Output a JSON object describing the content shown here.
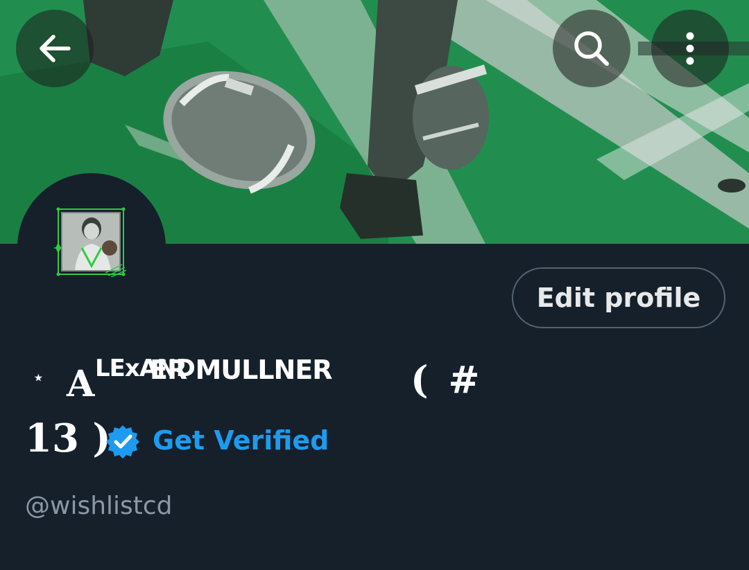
{
  "header": {
    "back_icon": "back-arrow-icon",
    "search_icon": "search-icon",
    "more_icon": "more-vertical-icon"
  },
  "profile": {
    "edit_label": "Edit profile",
    "name_star": "⋆",
    "name_cap_a": "A",
    "name_sup": "LExAND",
    "name_rest": "ER MULLNER",
    "name_paren_hash": "( #",
    "name_line2": "13 )",
    "verified_icon": "verified-badge-icon",
    "get_verified_label": "Get Verified",
    "handle": "@wishlistcd"
  },
  "colors": {
    "background": "#15202b",
    "banner_green": "#1f8a4c",
    "accent_blue": "#1d9bf0",
    "muted_text": "#8b98a5"
  }
}
